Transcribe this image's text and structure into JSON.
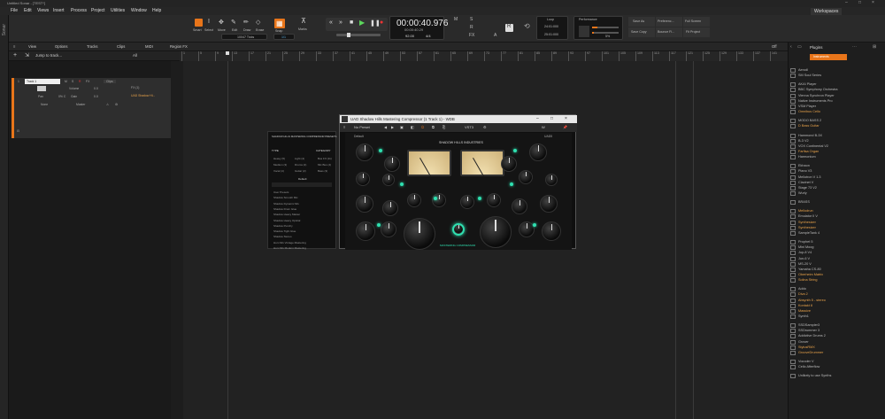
{
  "window": {
    "title": "Untitled Sonar - [TEST*]",
    "controls": [
      "–",
      "□",
      "×"
    ]
  },
  "menu": [
    "File",
    "Edit",
    "Views",
    "Insert",
    "Process",
    "Project",
    "Utilities",
    "Window",
    "Help"
  ],
  "workspace": "Workspaces",
  "tools": {
    "labels": [
      "Smart",
      "Select",
      "Move",
      "Edit",
      "Draw",
      "Erase"
    ],
    "snap_label": "Snap",
    "marks_label": "Marks",
    "ticks_value": "10047 Ticks",
    "snap_value": "1/1"
  },
  "transport": {
    "time": "00:00:40.976",
    "time_sub": "00:00:40.29",
    "tempo": "92.00",
    "meter": "4/4",
    "mode_letters": [
      "M",
      "S",
      "R",
      "FX",
      "A",
      "R"
    ]
  },
  "loop": {
    "label": "Loop",
    "start": "24:01:000",
    "end": "25:01:000"
  },
  "performance": {
    "label": "Performance",
    "value": "5%"
  },
  "buttons": {
    "save_as": "Save As",
    "preferences": "Preferenc...",
    "full_screen": "Full Screen",
    "save_copy": "Save Copy",
    "bounce": "Bounce Fi...",
    "fit_project": "Fit Project"
  },
  "track_toolbar": {
    "view": "View",
    "options": "Options",
    "tracks": "Tracks",
    "clips": "Clips",
    "midi": "MIDI",
    "region_fx": "Region FX",
    "off_label": "Off",
    "jump": "Jump to track...",
    "filter": "All"
  },
  "ruler_marks": [
    "1",
    "5",
    "9",
    "13",
    "17",
    "21",
    "25",
    "29",
    "33",
    "37",
    "41",
    "45",
    "49",
    "53",
    "57",
    "61",
    "65",
    "69",
    "73",
    "77",
    "81",
    "85",
    "89",
    "93",
    "97",
    "101",
    "105",
    "109",
    "113",
    "117",
    "121",
    "125",
    "129",
    "133",
    "137",
    "141"
  ],
  "track": {
    "name": "Track 1",
    "number": "1",
    "buttons": [
      "M",
      "S",
      "R",
      "FX"
    ],
    "clips_label": "Clips",
    "volume_label": "Volume",
    "volume_value": "0.0",
    "pan_label": "Pan",
    "pan_value": "0% C",
    "gain_label": "Gain",
    "gain_value": "0.0",
    "input": "None",
    "output": "Master",
    "fx_label": "FX (1)",
    "fx_plugin": "UAD Shadow Hi..."
  },
  "clip": {
    "name": "UAD Shadow Hi..."
  },
  "browser": {
    "tab_plugins": "Plugins",
    "tab_instruments": "Instruments",
    "items": [
      {
        "label": "Aerodl",
        "sel": false
      },
      {
        "label": "SM Soul Series",
        "sel": false
      },
      {
        "label": "AKAI Player",
        "sel": false
      },
      {
        "label": "BBC Symphony Orchestra",
        "sel": false
      },
      {
        "label": "Vienna Synchron Player",
        "sel": false
      },
      {
        "label": "Native Instruments Pro",
        "sel": false
      },
      {
        "label": "VSM Player",
        "sel": false
      },
      {
        "label": "Omnibus Cello",
        "sel": true
      },
      {
        "label": "MODO BASS 2",
        "sel": false
      },
      {
        "label": "D Bass Guitar",
        "sel": true
      },
      {
        "label": "Hammond B-3X",
        "sel": false
      },
      {
        "label": "B-3 V2",
        "sel": false
      },
      {
        "label": "VOX Continental V2",
        "sel": false
      },
      {
        "label": "Farfisa Organ",
        "sel": true
      },
      {
        "label": "Harmonium",
        "sel": false
      },
      {
        "label": "Ekhaon",
        "sel": false
      },
      {
        "label": "Piano V3",
        "sel": false
      },
      {
        "label": "Mellotron V 1.3",
        "sel": false
      },
      {
        "label": "Clavinet V",
        "sel": false
      },
      {
        "label": "Stage 73 V2",
        "sel": false
      },
      {
        "label": "Wurly",
        "sel": false
      },
      {
        "label": "BRASS",
        "sel": false
      },
      {
        "label": "Mellodrun",
        "sel": true
      },
      {
        "label": "Emulator II V",
        "sel": false
      },
      {
        "label": "Synthesizer",
        "sel": true
      },
      {
        "label": "Synthesizer",
        "sel": true
      },
      {
        "label": "SampleTank 4",
        "sel": false
      },
      {
        "label": "Prophet 5",
        "sel": false
      },
      {
        "label": "Mini Moog",
        "sel": false
      },
      {
        "label": "Jup-8 V4",
        "sel": false
      },
      {
        "label": "Jun-6 V",
        "sel": false
      },
      {
        "label": "MS-20 V",
        "sel": false
      },
      {
        "label": "Yamaha CS-80",
        "sel": false
      },
      {
        "label": "Oberheim Matrix",
        "sel": true
      },
      {
        "label": "Solina String",
        "sel": true
      },
      {
        "label": "Addo",
        "sel": false
      },
      {
        "label": "Diva 2",
        "sel": true
      },
      {
        "label": "Absynth 5 - stereo",
        "sel": true
      },
      {
        "label": "Kontakt 8",
        "sel": true
      },
      {
        "label": "Massive",
        "sel": true
      },
      {
        "label": "Synth1",
        "sel": false
      },
      {
        "label": "SSDSampler3",
        "sel": false
      },
      {
        "label": "SSDrummer 3",
        "sel": false
      },
      {
        "label": "Addictive Drums 2",
        "sel": false
      },
      {
        "label": "Grover",
        "sel": false
      },
      {
        "label": "StylusRMX",
        "sel": true
      },
      {
        "label": "GrooveDrummer",
        "sel": true
      },
      {
        "label": "Vocoder V",
        "sel": false
      },
      {
        "label": "Cello Afterflow",
        "sel": false
      },
      {
        "label": "Unlikely to use Synths",
        "sel": false
      }
    ]
  },
  "plugin": {
    "title": "UAD Shadow Hills Mastering Compressor (1 Track 1) - WDB",
    "preset": "No Preset",
    "brand": "SHADOW HILLS INDUSTRIES",
    "footer": "MASTERING COMPRESSOR",
    "vst_label": "VST3",
    "left_label": "Default",
    "right_label": "UAD5"
  },
  "preset_panel": {
    "title": "SHADOW HILLS MASTERING COMPRESSOR PRESETS",
    "tabs": [
      "TYPE",
      "CATEGORY"
    ],
    "items": [
      "Heavy (5)",
      "Light (4)",
      "Medium (3)",
      "Drums (2)",
      "Vocal (4)",
      "Guitar (2)"
    ],
    "items2": [
      "Bus FX (11)",
      "Mix Bus (4)",
      "Bass (3)"
    ],
    "section": "Default",
    "list": [
      "User Presets",
      "Shadow Smooth Mix",
      "Shadow Dynamic Mix",
      "Shadow Drum Glue",
      "Shadow Heavy Master",
      "Shadow Heavy Optical",
      "Shadow Punchy",
      "Shadow Tight Glue",
      "Shadow Stereo",
      "Hum Mix Vintage Mastering",
      "Hum Mix Modern Mastering"
    ]
  },
  "colors": {
    "accent": "#e8751a",
    "led": "#2fe0b0",
    "selected_item": "#e8a24a"
  }
}
